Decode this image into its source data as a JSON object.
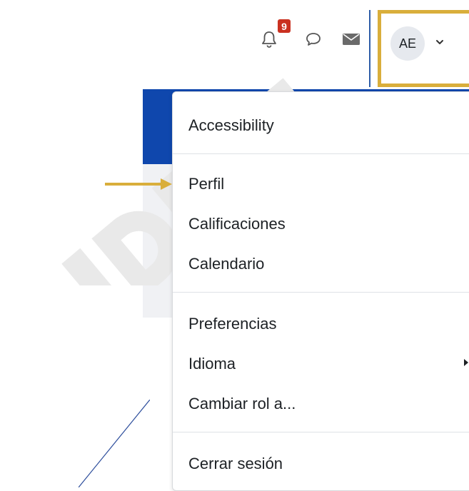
{
  "navbar": {
    "notifications_count": "9",
    "user_initials": "AE",
    "icons": [
      "bell-icon",
      "chat-icon",
      "envelope-icon",
      "chevron-down-icon"
    ]
  },
  "menu": {
    "items": [
      {
        "label": "Accessibility"
      },
      {
        "label": "Perfil"
      },
      {
        "label": "Calificaciones"
      },
      {
        "label": "Calendario"
      },
      {
        "label": "Preferencias"
      },
      {
        "label": "Idioma"
      },
      {
        "label": "Cambiar rol a..."
      },
      {
        "label": "Cerrar sesión"
      }
    ]
  },
  "colors": {
    "highlight_box": "#d9ae3b",
    "badge": "#ca3120",
    "header_band": "#0f47ad",
    "annotation_arrow": "#d9ae3b"
  }
}
